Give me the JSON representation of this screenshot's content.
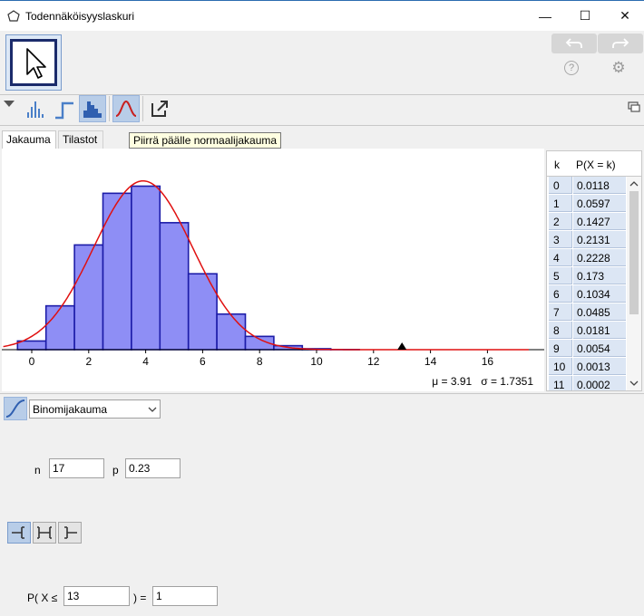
{
  "window": {
    "title": "Todennäköisyyslaskuri",
    "minimize_glyph": "—",
    "maximize_glyph": "☐",
    "close_glyph": "✕"
  },
  "toolbar": {
    "move_tool": "cursor-arrow-icon",
    "undo": "undo-icon",
    "redo": "redo-icon",
    "help": "help-icon",
    "settings": "gear-icon",
    "help_glyph": "?",
    "settings_glyph": "⚙"
  },
  "view_toolbar": {
    "buttons": [
      "bar-chart-icon",
      "step-chart-icon",
      "histogram-icon",
      "normal-curve-icon",
      "export-icon"
    ],
    "active": [
      "histogram-icon",
      "normal-curve-icon"
    ]
  },
  "tabs": [
    {
      "label": "Jakauma",
      "selected": true
    },
    {
      "label": "Tilastot",
      "selected": false
    }
  ],
  "tooltip": "Piirrä päälle normaalijakauma",
  "stats": {
    "mu_label": "μ = 3.91",
    "sigma_label": "σ = 1.7351"
  },
  "colors": {
    "bar_fill": "#8e8ef5",
    "bar_stroke": "#1c1ca8",
    "curve": "#e01010",
    "accent": "#b8cde8"
  },
  "chart_data": {
    "type": "bar",
    "x": [
      0,
      1,
      2,
      3,
      4,
      5,
      6,
      7,
      8,
      9,
      10,
      11
    ],
    "values": [
      0.0118,
      0.0597,
      0.1427,
      0.2131,
      0.2228,
      0.173,
      0.1034,
      0.0485,
      0.0181,
      0.0054,
      0.0013,
      0.0002
    ],
    "xlim": [
      -1,
      17.5
    ],
    "ylim": [
      0,
      0.25
    ],
    "xticks": [
      "0",
      "2",
      "4",
      "6",
      "8",
      "10",
      "12",
      "14",
      "16"
    ],
    "xtick_values": [
      0,
      2,
      4,
      6,
      8,
      10,
      12,
      14,
      16
    ],
    "normal_overlay": {
      "mu": 3.91,
      "sigma": 1.7351
    },
    "marker_x": 13
  },
  "table": {
    "headers": [
      "k",
      "P(X = k)"
    ],
    "rows": [
      [
        "0",
        "0.0118"
      ],
      [
        "1",
        "0.0597"
      ],
      [
        "2",
        "0.1427"
      ],
      [
        "3",
        "0.2131"
      ],
      [
        "4",
        "0.2228"
      ],
      [
        "5",
        "0.173"
      ],
      [
        "6",
        "0.1034"
      ],
      [
        "7",
        "0.0485"
      ],
      [
        "8",
        "0.0181"
      ],
      [
        "9",
        "0.0054"
      ],
      [
        "10",
        "0.0013"
      ],
      [
        "11",
        "0.0002"
      ]
    ]
  },
  "distribution": {
    "selected": "Binomijakauma"
  },
  "params": {
    "n_label": "n",
    "n_value": "17",
    "p_label": "p",
    "p_value": "0.23"
  },
  "interval_buttons": [
    "left-sided-icon",
    "two-sided-icon",
    "right-sided-icon"
  ],
  "probability": {
    "prefix": "P( X ≤",
    "bound": "13",
    "equals": ") =",
    "result": "1"
  }
}
